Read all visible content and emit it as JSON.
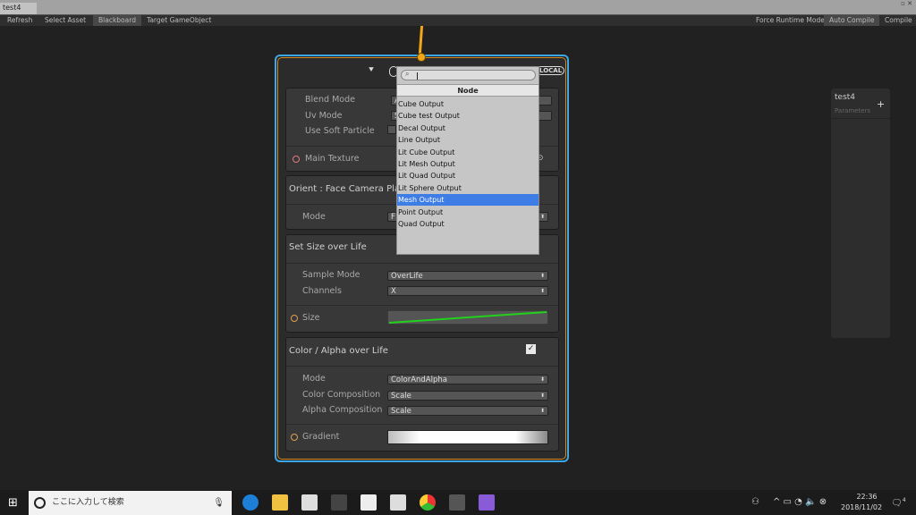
{
  "window": {
    "tab": "test4",
    "controls": "▫ ✕"
  },
  "toolbar": {
    "left": [
      "Refresh",
      "Select Asset",
      "Blackboard",
      "Target GameObject"
    ],
    "right": [
      "Force Runtime Mode",
      "Auto Compile",
      "Compile"
    ],
    "active": [
      "Blackboard",
      "Auto Compile"
    ]
  },
  "node": {
    "badge": "LOCAL",
    "output": {
      "rows": [
        {
          "label": "Blend Mode",
          "value": "A"
        },
        {
          "label": "Uv Mode",
          "value": "S"
        },
        {
          "label": "Use Soft Particle",
          "value": ""
        }
      ],
      "texture_label": "Main Texture"
    },
    "orient": {
      "title": "Orient : Face Camera Plane",
      "mode_label": "Mode",
      "mode_value": "F"
    },
    "size": {
      "title": "Set Size over Life",
      "sample_mode_label": "Sample Mode",
      "sample_mode": "OverLife",
      "channels_label": "Channels",
      "channels": "X",
      "size_label": "Size"
    },
    "color": {
      "title": "Color / Alpha over Life",
      "enabled": true,
      "mode_label": "Mode",
      "mode": "ColorAndAlpha",
      "color_comp_label": "Color Composition",
      "color_comp": "Scale",
      "alpha_comp_label": "Alpha Composition",
      "alpha_comp": "Scale",
      "gradient_label": "Gradient"
    }
  },
  "dropdown": {
    "search_value": "",
    "title": "Node",
    "items": [
      "Cube Output",
      "Cube test Output",
      "Decal Output",
      "Line Output",
      "Lit Cube Output",
      "Lit Mesh Output",
      "Lit Quad Output",
      "Lit Sphere Output",
      "Mesh Output",
      "Point Output",
      "Quad Output"
    ],
    "selected": "Mesh Output"
  },
  "blackboard": {
    "title": "test4",
    "subtitle": "Parameters",
    "add": "+"
  },
  "taskbar": {
    "search_placeholder": "ここに入力して検索",
    "time": "22:36",
    "date": "2018/11/02",
    "notifications": "4"
  },
  "colors": {
    "selection": "#3e7de6",
    "node_border": "#3fa7e6",
    "accent": "#f2a718",
    "curve": "#22d11c"
  }
}
